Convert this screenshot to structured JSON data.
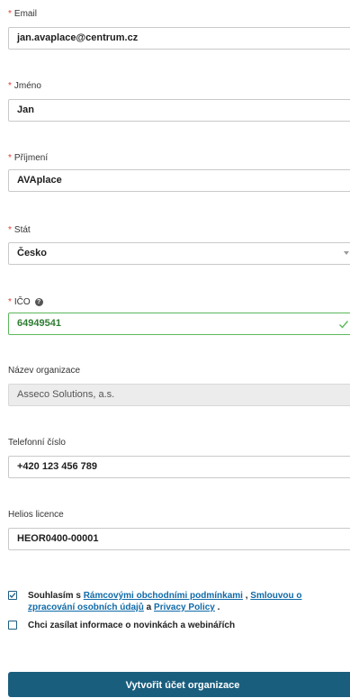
{
  "fields": {
    "email": {
      "label": "Email",
      "value": "jan.avaplace@centrum.cz"
    },
    "first_name": {
      "label": "Jméno",
      "value": "Jan"
    },
    "last_name": {
      "label": "Příjmení",
      "value": "AVAplace"
    },
    "country": {
      "label": "Stát",
      "value": "Česko"
    },
    "ico": {
      "label": "IČO",
      "value": "64949541"
    },
    "organization": {
      "label": "Název organizace",
      "value": "Asseco Solutions, a.s."
    },
    "phone": {
      "label": "Telefonní číslo",
      "value": "+420 123 456 789"
    },
    "helios": {
      "label": "Helios licence",
      "value": "HEOR0400-00001"
    }
  },
  "required_marker": "*",
  "consent": {
    "prefix": "Souhlasím s ",
    "terms_link": "Rámcovými obchodními podmínkami",
    "sep1": " , ",
    "privacy_link": "Smlouvou o zpracování osobních údajů",
    "sep2": " a ",
    "policy_link": "Privacy Policy",
    "suffix": " .",
    "checked": true
  },
  "newsletter": {
    "label": "Chci zasílat informace o novinkách a webinářích",
    "checked": false
  },
  "submit_label": "Vytvořit účet organizace",
  "colors": {
    "accent": "#1a5e7e",
    "valid": "#5cb85c",
    "required": "#e53935",
    "link": "#0f6aa8"
  },
  "icons": {
    "ico_help": "question-circle-icon",
    "valid": "checkmark-icon",
    "country_dropdown": "caret-down-icon"
  }
}
